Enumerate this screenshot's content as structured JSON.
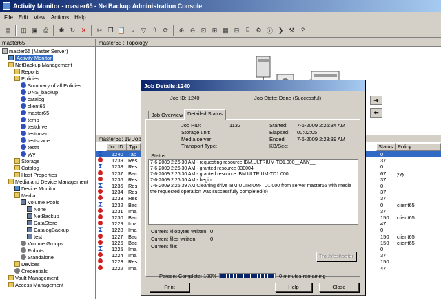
{
  "window": {
    "title": "Activity Monitor - master65 - NetBackup Administration Console"
  },
  "menu": [
    "File",
    "Edit",
    "View",
    "Actions",
    "Help"
  ],
  "left_pane": {
    "header": "master65",
    "tree": [
      {
        "label": "master65 (Master Server)",
        "icon": "server-icon",
        "level": 0
      },
      {
        "label": "Activity Monitor",
        "icon": "monitor-icon",
        "level": 1,
        "selected": true
      },
      {
        "label": "NetBackup Management",
        "icon": "folder-icon",
        "level": 1
      },
      {
        "label": "Reports",
        "icon": "folder-icon",
        "level": 2
      },
      {
        "label": "Policies",
        "icon": "folder-icon",
        "level": 2
      },
      {
        "label": "Summary of all Policies",
        "icon": "policy-icon",
        "level": 3
      },
      {
        "label": "DNS_backup",
        "icon": "policy-icon",
        "level": 3
      },
      {
        "label": "catalog",
        "icon": "policy-icon",
        "level": 3
      },
      {
        "label": "client65",
        "icon": "policy-icon",
        "level": 3
      },
      {
        "label": "master65",
        "icon": "policy-icon",
        "level": 3
      },
      {
        "label": "temp",
        "icon": "policy-icon",
        "level": 3
      },
      {
        "label": "testdrive",
        "icon": "policy-icon",
        "level": 3
      },
      {
        "label": "testmseo",
        "icon": "policy-icon",
        "level": 3
      },
      {
        "label": "testspace",
        "icon": "policy-icon",
        "level": 3
      },
      {
        "label": "testtt",
        "icon": "policy-icon",
        "level": 3
      },
      {
        "label": "yyy",
        "icon": "policy-icon",
        "level": 3
      },
      {
        "label": "Storage",
        "icon": "folder-icon",
        "level": 2
      },
      {
        "label": "Catalog",
        "icon": "folder-icon",
        "level": 2
      },
      {
        "label": "Host Properties",
        "icon": "folder-icon",
        "level": 2
      },
      {
        "label": "Media and Device Management",
        "icon": "folder-icon",
        "level": 1
      },
      {
        "label": "Device Monitor",
        "icon": "monitor-icon",
        "level": 2
      },
      {
        "label": "Media",
        "icon": "folder-icon",
        "level": 2
      },
      {
        "label": "Volume Pools",
        "icon": "pool-icon",
        "level": 3
      },
      {
        "label": "None",
        "icon": "pool-icon",
        "level": 4
      },
      {
        "label": "NetBackup",
        "icon": "pool-icon",
        "level": 4
      },
      {
        "label": "DataStore",
        "icon": "pool-icon",
        "level": 4
      },
      {
        "label": "CatalogBackup",
        "icon": "pool-icon",
        "level": 4
      },
      {
        "label": "test",
        "icon": "pool-icon",
        "level": 4
      },
      {
        "label": "Volume Groups",
        "icon": "gear-icon",
        "level": 3
      },
      {
        "label": "Robots",
        "icon": "gear-icon",
        "level": 3
      },
      {
        "label": "Standalone",
        "icon": "gear-icon",
        "level": 3
      },
      {
        "label": "Devices",
        "icon": "folder-icon",
        "level": 2
      },
      {
        "label": "Credentials",
        "icon": "gear-icon",
        "level": 2
      },
      {
        "label": "Vault Management",
        "icon": "folder-icon",
        "level": 1
      },
      {
        "label": "Access Management",
        "icon": "folder-icon",
        "level": 1
      }
    ]
  },
  "topology": {
    "header": "master65 : Topology"
  },
  "jobs": {
    "header": "master65: 19 Jobs (",
    "columns": {
      "jobid": "Job ID",
      "type": "Typ",
      "status": "Status",
      "policy": "Policy"
    },
    "rows": [
      {
        "id": "1240",
        "type": "Tap",
        "status": "0",
        "policy": "",
        "state": "ok"
      },
      {
        "id": "1239",
        "type": "Res",
        "status": "37",
        "policy": "",
        "state": "err"
      },
      {
        "id": "1238",
        "type": "Res",
        "status": "0",
        "policy": "",
        "state": "ok"
      },
      {
        "id": "1237",
        "type": "Bac",
        "status": "67",
        "policy": "yyy",
        "state": "err"
      },
      {
        "id": "1236",
        "type": "Res",
        "status": "37",
        "policy": "",
        "state": "err"
      },
      {
        "id": "1235",
        "type": "Res",
        "status": "0",
        "policy": "",
        "state": "ok"
      },
      {
        "id": "1234",
        "type": "Res",
        "status": "37",
        "policy": "",
        "state": "err"
      },
      {
        "id": "1233",
        "type": "Res",
        "status": "37",
        "policy": "",
        "state": "err"
      },
      {
        "id": "1232",
        "type": "Bac",
        "status": "0",
        "policy": "client65",
        "state": "ok"
      },
      {
        "id": "1231",
        "type": "Ima",
        "status": "37",
        "policy": "",
        "state": "err"
      },
      {
        "id": "1230",
        "type": "Bac",
        "status": "150",
        "policy": "client65",
        "state": "err"
      },
      {
        "id": "1229",
        "type": "Ima",
        "status": "47",
        "policy": "",
        "state": "err"
      },
      {
        "id": "1228",
        "type": "Ima",
        "status": "0",
        "policy": "",
        "state": "ok"
      },
      {
        "id": "1227",
        "type": "Bac",
        "status": "150",
        "policy": "client65",
        "state": "err"
      },
      {
        "id": "1226",
        "type": "Bac",
        "status": "150",
        "policy": "client65",
        "state": "err"
      },
      {
        "id": "1225",
        "type": "Ima",
        "status": "0",
        "policy": "",
        "state": "ok"
      },
      {
        "id": "1224",
        "type": "Ima",
        "status": "37",
        "policy": "",
        "state": "err"
      },
      {
        "id": "1223",
        "type": "Res",
        "status": "150",
        "policy": "",
        "state": "err"
      },
      {
        "id": "1222",
        "type": "Ima",
        "status": "47",
        "policy": "",
        "state": "err"
      }
    ]
  },
  "dialog": {
    "title": "Job Details:1240",
    "job_id_label": "Job ID: 1240",
    "job_state_label": "Job State: Done (Successful)",
    "tabs": [
      "Job Overview",
      "Detailed Status"
    ],
    "fields": {
      "pid_label": "Job PID:",
      "pid_value": "1132",
      "storage_label": "Storage unit:",
      "media_label": "Media server:",
      "transport_label": "Transport Type:",
      "started_label": "Started:",
      "started_value": "7-6-2009 2:26:34 AM",
      "elapsed_label": "Elapsed:",
      "elapsed_value": "00:02:05",
      "ended_label": "Ended:",
      "ended_value": "7-6-2009 2:28:39 AM",
      "kbsec_label": "KB/Sec:"
    },
    "status_label": "Status:",
    "status_lines": [
      "7-6-2009 2:26:30 AM - requesting resource IBM.ULTRIUM-TD1.000__ANY__",
      "7-6-2009 2:26:30 AM - granted resource 030004",
      "7-6-2009 2:26:30 AM - granted resource IBM.ULTRIUM-TD1.000",
      "7-6-2009 2:26:36 AM - begin",
      "7-6-2009 2:26:39 AM Cleaning drive IBM.ULTRIUM-TD1.000 from server master65 with media",
      "the requested operation was successfully completed(0)"
    ],
    "kb_written_label": "Current kilobytes written:",
    "kb_written_value": "0",
    "files_written_label": "Current files written:",
    "files_written_value": "0",
    "current_file_label": "Current file:",
    "troubleshooter": "Troubleshooter",
    "percent_label": "Percent Complete: 100%",
    "progress_fraction": 1.0,
    "remaining": "0 minutes remaining",
    "print": "Print",
    "help": "Help",
    "close": "Close"
  }
}
